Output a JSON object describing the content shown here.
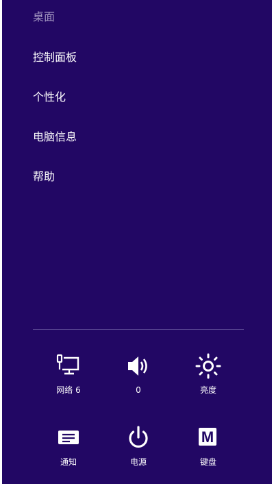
{
  "menu": {
    "items": [
      {
        "label": "桌面"
      },
      {
        "label": "控制面板"
      },
      {
        "label": "个性化"
      },
      {
        "label": "电脑信息"
      },
      {
        "label": "帮助"
      }
    ]
  },
  "quick_settings": {
    "row1": [
      {
        "icon": "network-icon",
        "label": "网络 6"
      },
      {
        "icon": "volume-icon",
        "label": "0"
      },
      {
        "icon": "brightness-icon",
        "label": "亮度"
      }
    ],
    "row2": [
      {
        "icon": "notifications-icon",
        "label": "通知"
      },
      {
        "icon": "power-icon",
        "label": "电源"
      },
      {
        "icon": "keyboard-icon",
        "glyph": "M",
        "label": "键盘"
      }
    ]
  },
  "colors": {
    "panel_background": "#220764",
    "text": "#ffffff",
    "divider": "#5a4792"
  }
}
